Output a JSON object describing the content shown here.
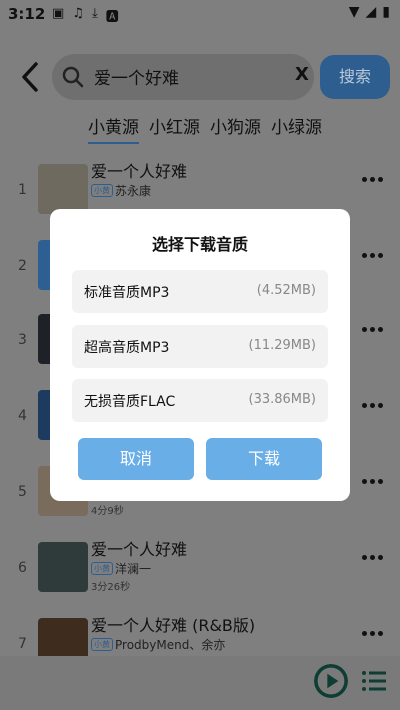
{
  "status_bar": {
    "time": "3:12",
    "icons": [
      "image-icon",
      "music-icon",
      "download-icon",
      "a-icon"
    ],
    "right_icons": [
      "wifi-icon",
      "signal-icon",
      "battery-icon"
    ]
  },
  "search": {
    "query": "爱一个好难",
    "clear_label": "X",
    "button_label": "搜索"
  },
  "tabs": [
    {
      "label": "小黄源",
      "active": true
    },
    {
      "label": "小红源",
      "active": false
    },
    {
      "label": "小狗源",
      "active": false
    },
    {
      "label": "小绿源",
      "active": false
    }
  ],
  "songs": [
    {
      "num": "1",
      "title": "爱一个人好难",
      "badge": "小黄",
      "artist": "苏永康",
      "duration": "",
      "thumb": "#6e6a60"
    },
    {
      "num": "2",
      "title": "",
      "badge": "",
      "artist": "",
      "duration": "",
      "thumb": "#2d5f93"
    },
    {
      "num": "3",
      "title": "",
      "badge": "",
      "artist": "",
      "duration": "",
      "thumb": "#1e2228"
    },
    {
      "num": "4",
      "title": "",
      "badge": "",
      "artist": "",
      "duration": "",
      "thumb": "#1d3b5e"
    },
    {
      "num": "5",
      "title": "",
      "badge": "",
      "artist": "",
      "duration": "4分9秒",
      "thumb": "#7a6c5c"
    },
    {
      "num": "6",
      "title": "爱一个人好难",
      "badge": "小黄",
      "artist": "洋澜一",
      "duration": "3分26秒",
      "thumb": "#2f3a3a"
    },
    {
      "num": "7",
      "title": "爱一个人好难 (R&B版)",
      "badge": "小黄",
      "artist": "ProdbyMend、余亦",
      "duration": "",
      "thumb": "#3e2c1e"
    }
  ],
  "dialog": {
    "title": "选择下载音质",
    "options": [
      {
        "name": "标准音质MP3",
        "size": "(4.52MB)"
      },
      {
        "name": "超高音质MP3",
        "size": "(11.29MB)"
      },
      {
        "name": "无损音质FLAC",
        "size": "(33.86MB)"
      }
    ],
    "cancel_label": "取消",
    "download_label": "下载"
  },
  "colors": {
    "accent": "#6aaee8",
    "search_button": "#2e5e8f",
    "overlay": "#7f7f7f",
    "play": "#0e3d33"
  }
}
